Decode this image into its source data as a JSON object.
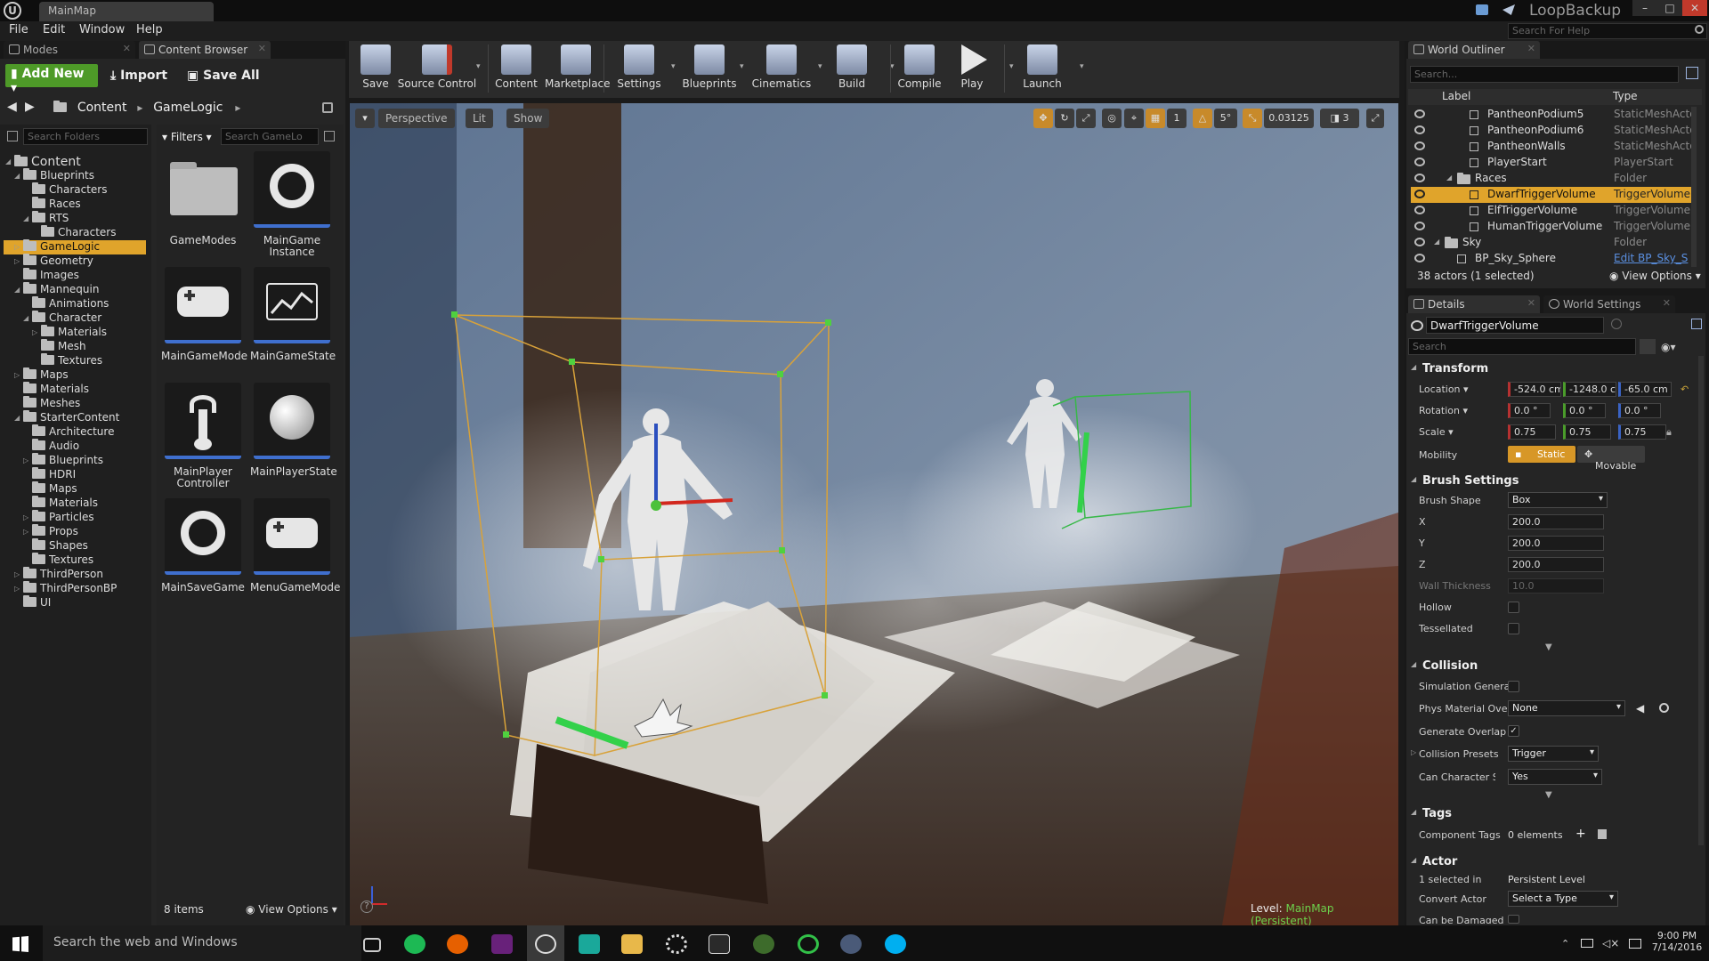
{
  "window": {
    "tab_title": "MainMap",
    "project_name": "LoopBackup",
    "help_search_placeholder": "Search For Help"
  },
  "menu": [
    "File",
    "Edit",
    "Window",
    "Help"
  ],
  "left_tabs": {
    "modes": "Modes",
    "content_browser": "Content Browser"
  },
  "content_browser": {
    "add_new": "Add New",
    "import": "Import",
    "save_all": "Save All",
    "breadcrumb": [
      "Content",
      "GameLogic"
    ],
    "search_folders_placeholder": "Search Folders",
    "filters": "Filters",
    "search_assets_placeholder": "Search GameLo",
    "items_count": "8 items",
    "view_options": "View Options",
    "tree": [
      {
        "label": "Content",
        "depth": 0,
        "root": true
      },
      {
        "label": "Blueprints",
        "depth": 1
      },
      {
        "label": "Characters",
        "depth": 2
      },
      {
        "label": "Races",
        "depth": 2
      },
      {
        "label": "RTS",
        "depth": 2
      },
      {
        "label": "Characters",
        "depth": 3
      },
      {
        "label": "GameLogic",
        "depth": 1,
        "selected": true
      },
      {
        "label": "Geometry",
        "depth": 1
      },
      {
        "label": "Images",
        "depth": 1
      },
      {
        "label": "Mannequin",
        "depth": 1
      },
      {
        "label": "Animations",
        "depth": 2
      },
      {
        "label": "Character",
        "depth": 2
      },
      {
        "label": "Materials",
        "depth": 3
      },
      {
        "label": "Mesh",
        "depth": 3
      },
      {
        "label": "Textures",
        "depth": 3
      },
      {
        "label": "Maps",
        "depth": 1
      },
      {
        "label": "Materials",
        "depth": 1
      },
      {
        "label": "Meshes",
        "depth": 1
      },
      {
        "label": "StarterContent",
        "depth": 1
      },
      {
        "label": "Architecture",
        "depth": 2
      },
      {
        "label": "Audio",
        "depth": 2
      },
      {
        "label": "Blueprints",
        "depth": 2
      },
      {
        "label": "HDRI",
        "depth": 2
      },
      {
        "label": "Maps",
        "depth": 2
      },
      {
        "label": "Materials",
        "depth": 2
      },
      {
        "label": "Particles",
        "depth": 2
      },
      {
        "label": "Props",
        "depth": 2
      },
      {
        "label": "Shapes",
        "depth": 2
      },
      {
        "label": "Textures",
        "depth": 2
      },
      {
        "label": "ThirdPerson",
        "depth": 1
      },
      {
        "label": "ThirdPersonBP",
        "depth": 1
      },
      {
        "label": "UI",
        "depth": 1
      }
    ],
    "assets": [
      {
        "label": "GameModes",
        "icon": "folder-icon"
      },
      {
        "label": "MainGame Instance",
        "icon": "ring-icon"
      },
      {
        "label": "MainGameMode",
        "icon": "gamepad-icon"
      },
      {
        "label": "MainGameState",
        "icon": "graph-icon"
      },
      {
        "label": "MainPlayer Controller",
        "icon": "controller-icon"
      },
      {
        "label": "MainPlayerState",
        "icon": "sphere-icon"
      },
      {
        "label": "MainSaveGame",
        "icon": "ring-icon"
      },
      {
        "label": "MenuGameMode",
        "icon": "gamepad-icon"
      }
    ]
  },
  "toolbar": [
    {
      "label": "Save",
      "icon": "save-icon"
    },
    {
      "label": "Source Control",
      "icon": "source-control-icon"
    },
    {
      "label": "Content",
      "icon": "content-icon"
    },
    {
      "label": "Marketplace",
      "icon": "marketplace-icon"
    },
    {
      "label": "Settings",
      "icon": "settings-icon"
    },
    {
      "label": "Blueprints",
      "icon": "blueprints-icon"
    },
    {
      "label": "Cinematics",
      "icon": "cinematics-icon"
    },
    {
      "label": "Build",
      "icon": "build-icon"
    },
    {
      "label": "Compile",
      "icon": "compile-icon"
    },
    {
      "label": "Play",
      "icon": "play-icon"
    },
    {
      "label": "Launch",
      "icon": "launch-icon"
    }
  ],
  "viewport": {
    "perspective": "Perspective",
    "lit": "Lit",
    "show": "Show",
    "grid_snap": "1",
    "rotation_snap": "5°",
    "scale_snap": "0.03125",
    "camera_speed": "3",
    "level_label": "Level:",
    "level_name": "MainMap (Persistent)"
  },
  "world_outliner": {
    "tab": "World Outliner",
    "search_placeholder": "Search...",
    "col_label": "Label",
    "col_type": "Type",
    "rows": [
      {
        "label": "PantheonPodium5",
        "type": "StaticMeshActo",
        "depth": 3
      },
      {
        "label": "PantheonPodium6",
        "type": "StaticMeshActo",
        "depth": 3
      },
      {
        "label": "PantheonWalls",
        "type": "StaticMeshActo",
        "depth": 3
      },
      {
        "label": "PlayerStart",
        "type": "PlayerStart",
        "depth": 3
      },
      {
        "label": "Races",
        "type": "Folder",
        "depth": 2,
        "folder": true
      },
      {
        "label": "DwarfTriggerVolume",
        "type": "TriggerVolume",
        "depth": 3,
        "selected": true
      },
      {
        "label": "ElfTriggerVolume",
        "type": "TriggerVolume",
        "depth": 3
      },
      {
        "label": "HumanTriggerVolume",
        "type": "TriggerVolume",
        "depth": 3
      },
      {
        "label": "Sky",
        "type": "Folder",
        "depth": 1,
        "folder": true
      },
      {
        "label": "BP_Sky_Sphere",
        "type": "Edit BP_Sky_S",
        "depth": 2,
        "link": true
      }
    ],
    "status": "38 actors (1 selected)",
    "view_options": "View Options"
  },
  "details": {
    "tab": "Details",
    "tab2": "World Settings",
    "actor_name": "DwarfTriggerVolume",
    "search_placeholder": "Search",
    "transform": {
      "title": "Transform",
      "location_label": "Location",
      "location": [
        "-524.0 cm",
        "-1248.0 c",
        "-65.0 cm"
      ],
      "rotation_label": "Rotation",
      "rotation": [
        "0.0 °",
        "0.0 °",
        "0.0 °"
      ],
      "scale_label": "Scale",
      "scale": [
        "0.75",
        "0.75",
        "0.75"
      ],
      "mobility_label": "Mobility",
      "mobility_static": "Static",
      "mobility_movable": "Movable"
    },
    "brush": {
      "title": "Brush Settings",
      "shape_label": "Brush Shape",
      "shape_value": "Box",
      "x_label": "X",
      "x": "200.0",
      "y_label": "Y",
      "y": "200.0",
      "z_label": "Z",
      "z": "200.0",
      "wall_label": "Wall Thickness",
      "wall": "10.0",
      "hollow_label": "Hollow",
      "tess_label": "Tessellated"
    },
    "collision": {
      "title": "Collision",
      "sim_label": "Simulation Generat",
      "phys_label": "Phys Material Ove",
      "phys_value": "None",
      "overlap_label": "Generate Overlap E",
      "presets_label": "Collision Presets",
      "presets_value": "Trigger",
      "step_label": "Can Character Step",
      "step_value": "Yes"
    },
    "tags": {
      "title": "Tags",
      "label": "Component Tags",
      "value": "0 elements"
    },
    "actor": {
      "title": "Actor",
      "selected_label": "1 selected in",
      "selected_value": "Persistent Level",
      "convert_label": "Convert Actor",
      "convert_value": "Select a Type",
      "damaged_label": "Can be Damaged"
    }
  },
  "taskbar": {
    "search_text": "Search the web and Windows",
    "time": "9:00 PM",
    "date": "7/14/2016"
  }
}
